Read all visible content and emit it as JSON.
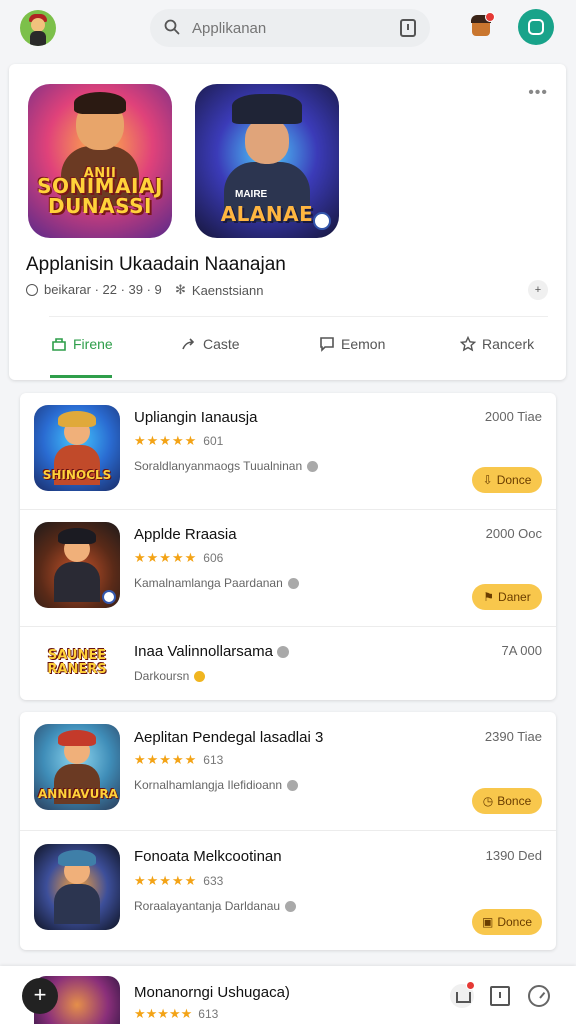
{
  "topbar": {
    "search_placeholder": "Applikanan",
    "icons": [
      "avatar-logo",
      "search-icon",
      "scan-icon",
      "notification-avatar",
      "profile-icon"
    ]
  },
  "featured": {
    "art_a_title": "SONIMAIAJ DUNASSI",
    "art_a_top": "ANII",
    "art_b_top": "MAIRE",
    "art_b_title": "ALANAE",
    "title": "Applanisin Ukaadain Naanajan",
    "meta_left": "beikarar · 22 · 39 · 9",
    "meta_right": "Kaenstsiann",
    "tabs": [
      {
        "label": "Firene"
      },
      {
        "label": "Caste"
      },
      {
        "label": "Eemon"
      },
      {
        "label": "Rancerk"
      }
    ]
  },
  "list_group_1": [
    {
      "title": "Upliangin Ianausja",
      "stars": "★★★★★",
      "rating": "601",
      "sub": "Soraldlanyanmaogs Tuualninan",
      "count": "2000 Tiae",
      "button": "Donce",
      "icon_label": "SHINOCLS"
    },
    {
      "title": "Applde Rraasia",
      "stars": "★★★★★",
      "rating": "606",
      "sub": "Kamalnamlanga Paardanan",
      "count": "2000 Ooc",
      "button": "Daner",
      "icon_label": ""
    },
    {
      "title": "Inaa Valinnollarsama",
      "sub": "Darkoursn",
      "count": "7A 000",
      "icon_label": "SAUNEE RANERS"
    }
  ],
  "list_group_2": [
    {
      "title": "Aeplitan Pendegal lasadlai 3",
      "stars": "★★★★★",
      "rating": "613",
      "sub": "Kornalhamlangja Ilefidioann",
      "count": "2390 Tiae",
      "button": "Bonce",
      "icon_label": "ANNIAVURA"
    },
    {
      "title": "Fonoata Melkcootinan",
      "stars": "★★★★★",
      "rating": "633",
      "sub": "Roraalayantanja Darldanau",
      "count": "1390 Ded",
      "button": "Donce",
      "icon_label": ""
    }
  ],
  "bottom": {
    "title": "Monanorngi Ushugaca)",
    "stars": "★★★★★",
    "rating": "613"
  },
  "colors": {
    "accent_green": "#2e9e4a",
    "star": "#f3a316",
    "button": "#f8c74c",
    "profile": "#18a38a"
  }
}
